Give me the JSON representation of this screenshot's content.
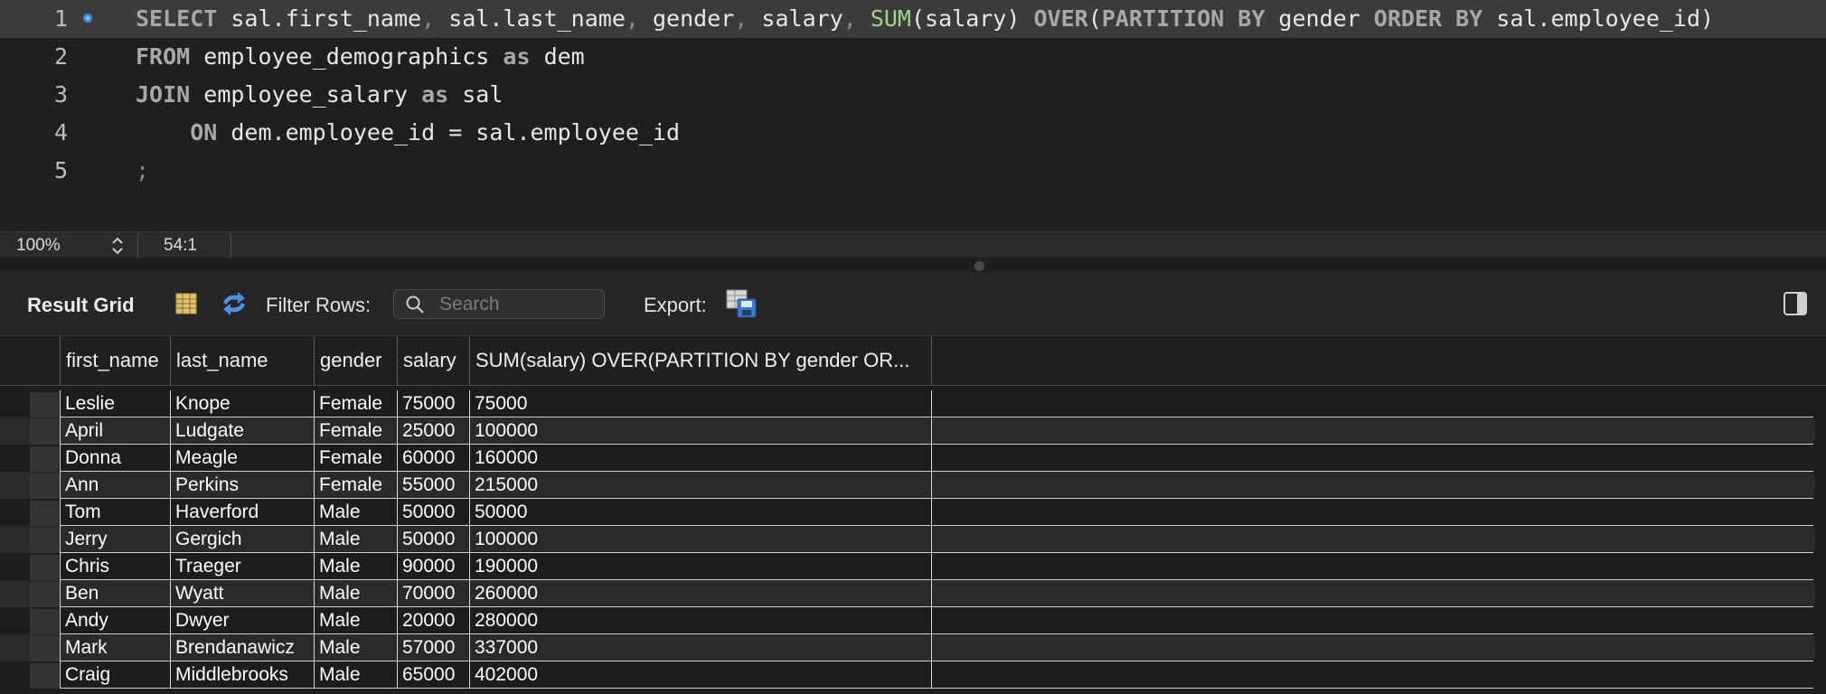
{
  "editor": {
    "line_numbers": [
      "1",
      "2",
      "3",
      "4",
      "5"
    ],
    "lines": {
      "l1": {
        "kw1": "SELECT",
        "t1": " sal.first_name",
        "c1": ",",
        "t2": " sal.last_name",
        "c2": ",",
        "t3": " gender",
        "c3": ",",
        "t4": " salary",
        "c4": ",",
        "fn": " SUM",
        "t5": "(salary) ",
        "kw2": "OVER",
        "t6": "(",
        "kw3": "PARTITION BY",
        "t7": " gender ",
        "kw4": "ORDER BY",
        "t8": " sal.employee_id)"
      },
      "l2": {
        "kw1": "FROM",
        "t1": " employee_demographics ",
        "kw2": "as",
        "t2": " dem"
      },
      "l3": {
        "kw1": "JOIN",
        "t1": " employee_salary ",
        "kw2": "as",
        "t2": " sal"
      },
      "l4": {
        "indent": "    ",
        "kw1": "ON",
        "t1": " dem.employee_id = sal.employee_id"
      },
      "l5": {
        "t1": ";"
      }
    }
  },
  "status_bar": {
    "zoom": "100%",
    "cursor_position": "54:1"
  },
  "toolbar": {
    "title": "Result Grid",
    "filter_label": "Filter Rows:",
    "search_placeholder": "Search",
    "export_label": "Export:"
  },
  "grid": {
    "columns": [
      "first_name",
      "last_name",
      "gender",
      "salary",
      "SUM(salary) OVER(PARTITION BY gender OR..."
    ],
    "rows": [
      [
        "Leslie",
        "Knope",
        "Female",
        "75000",
        "75000"
      ],
      [
        "April",
        "Ludgate",
        "Female",
        "25000",
        "100000"
      ],
      [
        "Donna",
        "Meagle",
        "Female",
        "60000",
        "160000"
      ],
      [
        "Ann",
        "Perkins",
        "Female",
        "55000",
        "215000"
      ],
      [
        "Tom",
        "Haverford",
        "Male",
        "50000",
        "50000"
      ],
      [
        "Jerry",
        "Gergich",
        "Male",
        "50000",
        "100000"
      ],
      [
        "Chris",
        "Traeger",
        "Male",
        "90000",
        "190000"
      ],
      [
        "Ben",
        "Wyatt",
        "Male",
        "70000",
        "260000"
      ],
      [
        "Andy",
        "Dwyer",
        "Male",
        "20000",
        "280000"
      ],
      [
        "Mark",
        "Brendanawicz",
        "Male",
        "57000",
        "337000"
      ],
      [
        "Craig",
        "Middlebrooks",
        "Male",
        "65000",
        "402000"
      ]
    ]
  },
  "colors": {
    "accent_breakpoint": "#3d8ee8",
    "keyword": "#a8a8a8",
    "function": "#9fd48c"
  },
  "icons": {
    "breakpoint": "breakpoint-dot-icon",
    "zoom_stepper": "up-down-stepper-icon",
    "grid_view": "grid-view-icon",
    "refresh": "refresh-icon",
    "search": "search-icon",
    "export": "export-icon",
    "panel_toggle": "panel-toggle-icon"
  }
}
